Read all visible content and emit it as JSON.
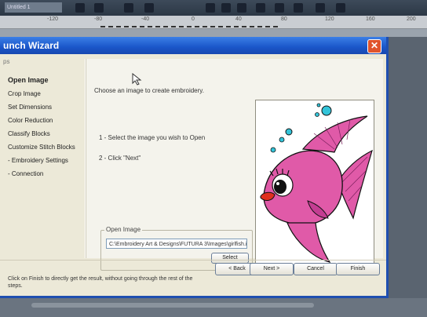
{
  "toolbar": {
    "file_field": "Untitled 1"
  },
  "ruler": {
    "labels": [
      "-120",
      "-80",
      "-40",
      "0",
      "40",
      "80",
      "120",
      "160",
      "200"
    ]
  },
  "dialog": {
    "title": "unch Wizard",
    "steps_header": "ps",
    "steps": [
      {
        "label": "Open Image",
        "active": true
      },
      {
        "label": "Crop Image",
        "active": false
      },
      {
        "label": "Set Dimensions",
        "active": false
      },
      {
        "label": "Color Reduction",
        "active": false
      },
      {
        "label": "Classify Blocks",
        "active": false
      },
      {
        "label": "Customize Stitch Blocks",
        "active": false
      },
      {
        "label": "- Embroidery Settings",
        "active": false
      },
      {
        "label": "- Connection",
        "active": false
      }
    ],
    "intro": "Choose an image to create embroidery.",
    "instructions": [
      "1 -  Select the image you wish to Open",
      "2 -  Click \"Next\""
    ],
    "open_image": {
      "legend": "Open Image",
      "path": "C:\\Embroidery Art & Designs\\FUTURA 3\\Images\\girlfish.i",
      "select_label": "Select"
    },
    "buttons": {
      "back": "< Back",
      "next": "Next >",
      "cancel": "Cancel",
      "finish": "Finish"
    },
    "hint": "Click on Finish to directly get the result, without going through the rest of the steps."
  },
  "colors": {
    "title_blue": "#1a56c9",
    "fish_pink": "#e05aa8",
    "bubble_cyan": "#33c4d9"
  }
}
